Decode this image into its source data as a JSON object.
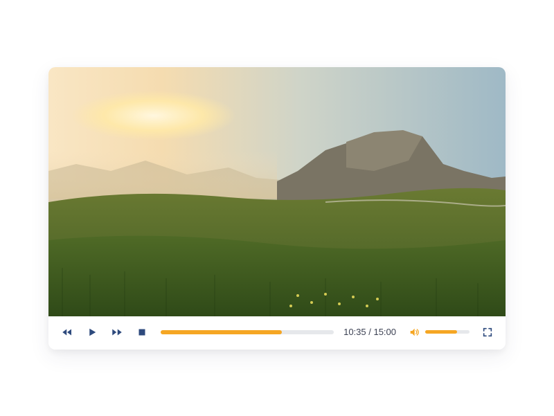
{
  "player": {
    "time_display": "10:35 / 15:00",
    "progress_percent": 70,
    "volume_percent": 72,
    "colors": {
      "accent": "#f5a623",
      "control": "#2e4a7d",
      "track_bg": "#e6e8eb"
    },
    "icons": {
      "rewind": "rewind-icon",
      "play": "play-icon",
      "forward": "forward-icon",
      "stop": "stop-icon",
      "volume": "volume-icon",
      "fullscreen": "fullscreen-icon"
    }
  }
}
